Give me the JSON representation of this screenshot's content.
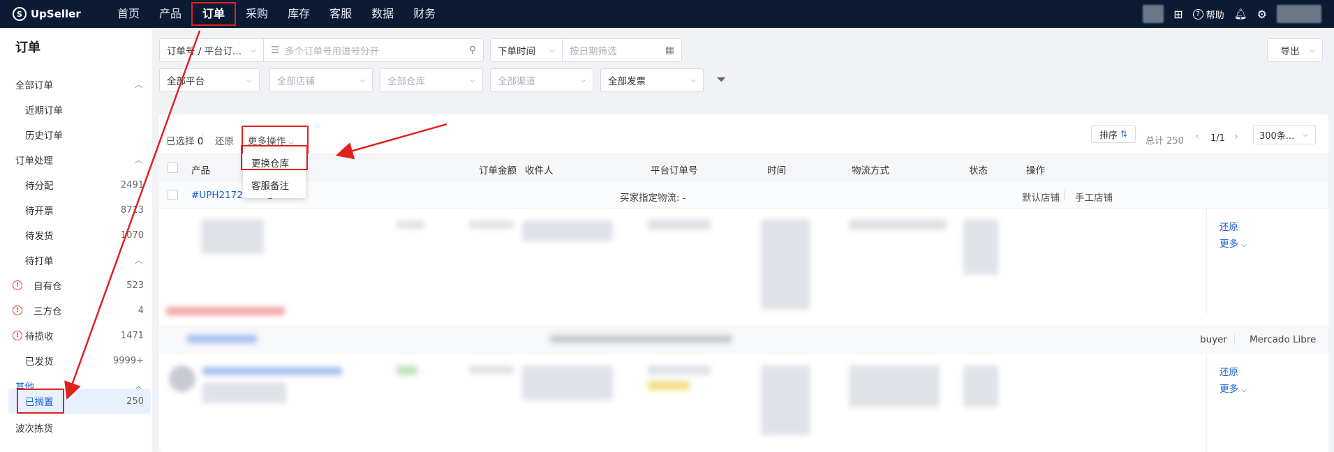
{
  "topnav": {
    "brand": "UpSeller",
    "items": [
      "首页",
      "产品",
      "订单",
      "采购",
      "库存",
      "客服",
      "数据",
      "财务"
    ],
    "active": "订单",
    "help_label": "帮助"
  },
  "sidebar": {
    "title": "订单",
    "sections": [
      {
        "label": "全部订单",
        "expanded": true,
        "items": [
          {
            "label": "近期订单",
            "count": ""
          },
          {
            "label": "历史订单",
            "count": ""
          }
        ]
      },
      {
        "label": "订单处理",
        "expanded": true,
        "items": [
          {
            "label": "待分配",
            "count": "2491"
          },
          {
            "label": "待开票",
            "count": "8713"
          },
          {
            "label": "待发货",
            "count": "1070"
          }
        ]
      },
      {
        "label": "待打单",
        "expanded": true,
        "items": [
          {
            "label": "自有仓",
            "count": "523"
          },
          {
            "label": "三方仓",
            "count": "4"
          },
          {
            "label": "待揽收",
            "count": "1471"
          },
          {
            "label": "已发货",
            "count": "9999+"
          }
        ]
      },
      {
        "label": "其他",
        "expanded": true,
        "items": [
          {
            "label": "已搁置",
            "count": "250"
          }
        ]
      }
    ],
    "last_item": "波次拣货"
  },
  "filters": {
    "order_field": "订单号 / 平台订...",
    "order_placeholder": "多个订单号用逗号分开",
    "time_field": "下单时间",
    "date_placeholder": "按日期筛选",
    "platform": "全部平台",
    "shop_placeholder": "全部店铺",
    "warehouse_placeholder": "全部仓库",
    "channel_placeholder": "全部渠道",
    "invoice": "全部发票",
    "export_label": "导出"
  },
  "toolbar": {
    "selected_label": "已选择",
    "selected_count": "0",
    "restore_label": "还原",
    "more_ops_label": "更多操作",
    "dropdown_options": [
      "更换仓库",
      "客服备注"
    ],
    "sort_label": "排序",
    "total_label": "总计 250",
    "page_label": "1/1",
    "page_size": "300条..."
  },
  "table": {
    "columns": [
      "产品",
      "订单金额",
      "收件人",
      "平台订单号",
      "时间",
      "物流方式",
      "状态",
      "操作"
    ],
    "group1": {
      "order_id": "#UPH217217",
      "buyer_logistics": "买家指定物流: -",
      "shop_default": "默认店铺",
      "shop_manual": "手工店铺",
      "actions": [
        "还原",
        "更多"
      ]
    },
    "group2": {
      "right_labels": [
        "buyer",
        "Mercado Libre"
      ],
      "actions": [
        "还原",
        "更多"
      ]
    }
  },
  "colors": {
    "nav_bg": "#0b1b33",
    "accent": "#1a5fd6",
    "highlight": "#e02020"
  }
}
